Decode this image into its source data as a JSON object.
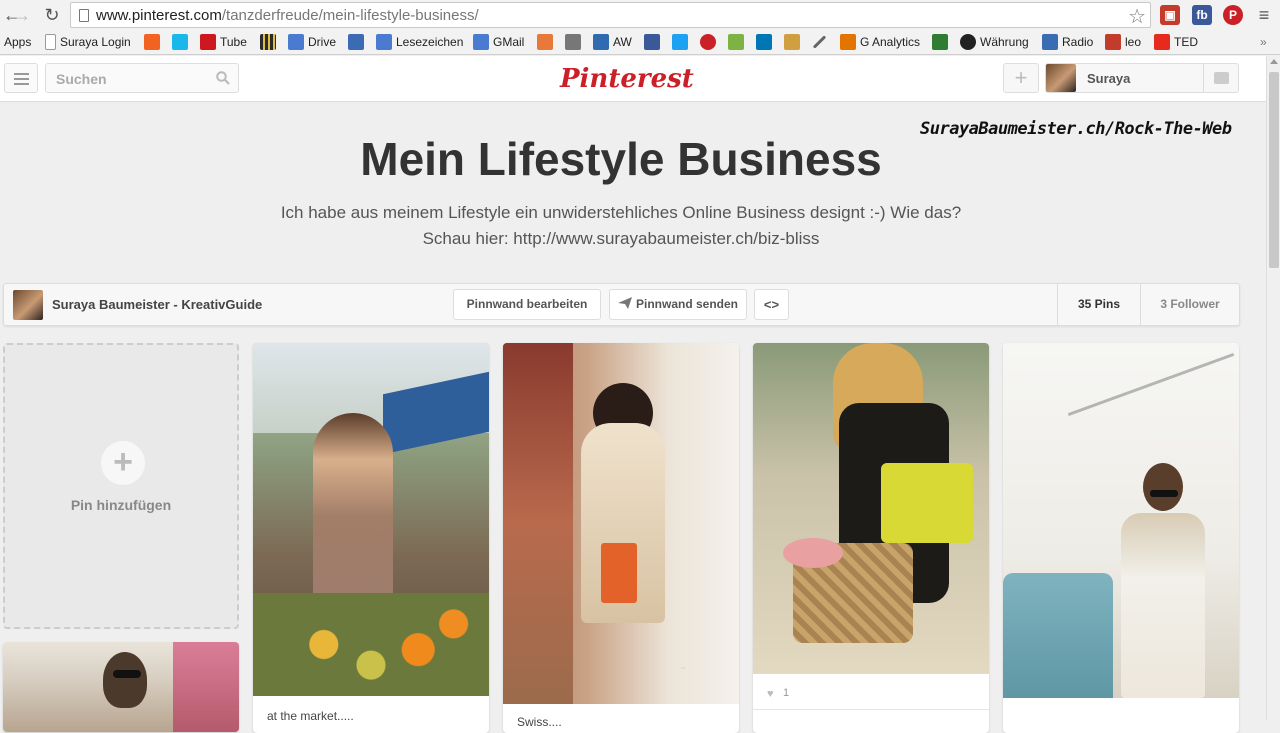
{
  "browser": {
    "url_domain": "www.pinterest.com",
    "url_path": "/tanzderfreude/mein-lifestyle-business/"
  },
  "bookmarks": [
    {
      "label": "Apps",
      "color": ""
    },
    {
      "label": "Suraya Login",
      "color": "#ffffff"
    },
    {
      "label": "",
      "color": "#f26322"
    },
    {
      "label": "",
      "color": "#1ab7ea"
    },
    {
      "label": "Tube",
      "color": "#cc181e"
    },
    {
      "label": "",
      "color": "#2b2b2b"
    },
    {
      "label": "Drive",
      "color": "#4a7bd0"
    },
    {
      "label": "",
      "color": "#3b6bb2"
    },
    {
      "label": "Lesezeichen",
      "color": "#4a7bd0"
    },
    {
      "label": "GMail",
      "color": "#4a7bd0"
    },
    {
      "label": "",
      "color": "#e8793b"
    },
    {
      "label": "",
      "color": "#777777"
    },
    {
      "label": "AW",
      "color": "#2f6bb0"
    },
    {
      "label": "",
      "color": "#3b5998"
    },
    {
      "label": "",
      "color": "#1da1f2"
    },
    {
      "label": "",
      "color": "#cb2027"
    },
    {
      "label": "",
      "color": "#7cb342"
    },
    {
      "label": "",
      "color": "#0077b5"
    },
    {
      "label": "",
      "color": "#d0a040"
    },
    {
      "label": "",
      "color": "#666666"
    },
    {
      "label": "G Analytics",
      "color": "#e37400"
    },
    {
      "label": "",
      "color": "#2e7d32"
    },
    {
      "label": "Währung",
      "color": "#222222"
    },
    {
      "label": "Radio",
      "color": "#3b6bb2"
    },
    {
      "label": "leo",
      "color": "#c33b2b"
    },
    {
      "label": "TED",
      "color": "#e62b1e"
    }
  ],
  "header": {
    "search_placeholder": "Suchen",
    "logo": "Pinterest",
    "user_name": "Suraya"
  },
  "watermark": "SurayaBaumeister.ch/Rock-The-Web",
  "board": {
    "title": "Mein Lifestyle Business",
    "description_line1": "Ich habe aus meinem Lifestyle ein unwiderstehliches Online Business designt :-) Wie das?",
    "description_line2": "Schau hier: http://www.surayabaumeister.ch/biz-bliss",
    "owner": "Suraya Baumeister - KreativGuide",
    "edit_label": "Pinnwand bearbeiten",
    "send_label": "Pinnwand senden",
    "embed_label": "<>",
    "pins_count": "35 Pins",
    "followers": "3 Follower"
  },
  "add_pin_label": "Pin hinzufügen",
  "pins": [
    {
      "description": "at the market.....",
      "likes": "",
      "colors": [
        "#6a7f5a",
        "#c9a47f",
        "#e6a23a"
      ]
    },
    {
      "description": "Swiss....",
      "likes": "",
      "colors": [
        "#b88a68",
        "#efe6d8",
        "#d86a2e"
      ]
    },
    {
      "description": "",
      "likes": "1",
      "colors": [
        "#5d6b4a",
        "#e2c068",
        "#c7a770"
      ]
    },
    {
      "description": "",
      "likes": "",
      "colors": [
        "#f3f3f0",
        "#d7d3c9",
        "#6aa7b3"
      ]
    }
  ]
}
